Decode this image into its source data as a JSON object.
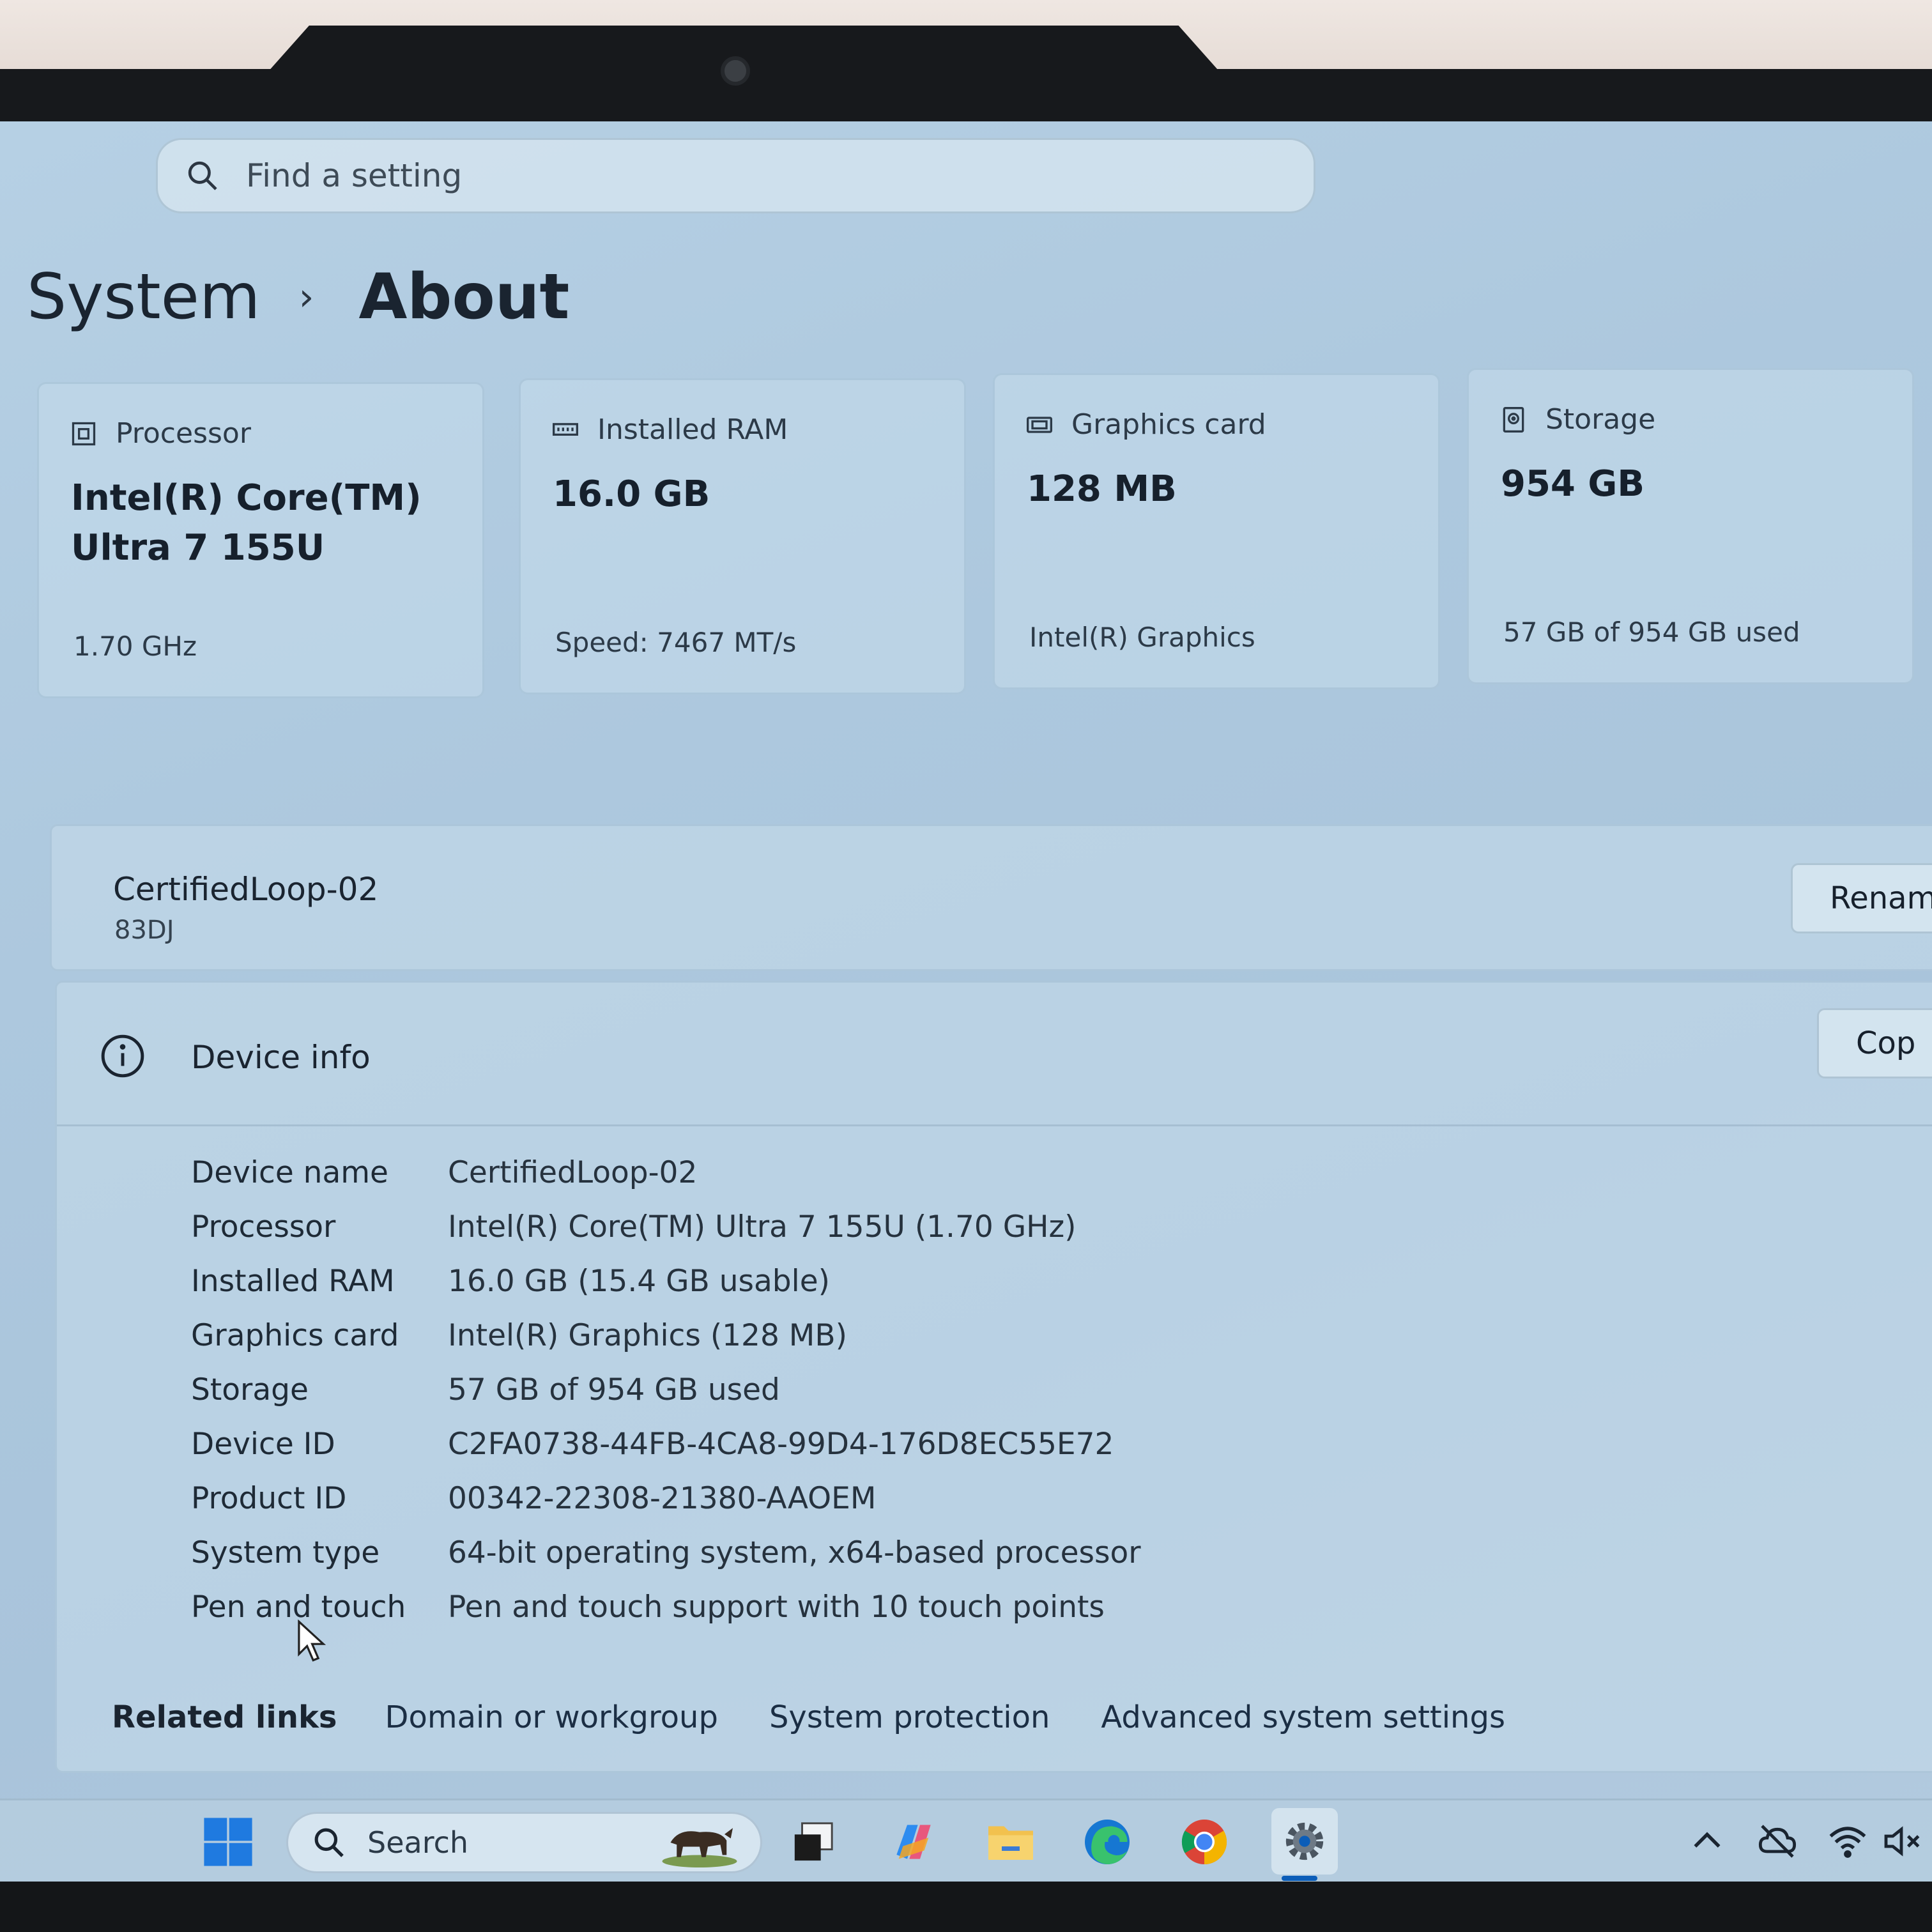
{
  "search": {
    "placeholder": "Find a setting"
  },
  "breadcrumb": {
    "root": "System",
    "separator": "›",
    "current": "About"
  },
  "cards": [
    {
      "title": "Processor",
      "icon": "processor-icon",
      "value": "Intel(R) Core(TM) Ultra 7 155U",
      "sub": "1.70 GHz"
    },
    {
      "title": "Installed RAM",
      "icon": "ram-icon",
      "value": "16.0 GB",
      "sub": "Speed: 7467 MT/s"
    },
    {
      "title": "Graphics card",
      "icon": "graphics-card-icon",
      "value": "128 MB",
      "sub": "Intel(R) Graphics"
    },
    {
      "title": "Storage",
      "icon": "storage-icon",
      "value": "954 GB",
      "sub": "57 GB of 954 GB used"
    }
  ],
  "device": {
    "name": "CertifiedLoop-02",
    "model": "83DJ",
    "rename_label": "Rename"
  },
  "device_info": {
    "title": "Device info",
    "copy_label": "Cop",
    "rows": [
      {
        "label": "Device name",
        "value": "CertifiedLoop-02"
      },
      {
        "label": "Processor",
        "value": "Intel(R) Core(TM) Ultra 7 155U (1.70 GHz)"
      },
      {
        "label": "Installed RAM",
        "value": "16.0 GB (15.4 GB usable)"
      },
      {
        "label": "Graphics card",
        "value": "Intel(R) Graphics (128 MB)"
      },
      {
        "label": "Storage",
        "value": "57 GB of 954 GB used"
      },
      {
        "label": "Device ID",
        "value": "C2FA0738-44FB-4CA8-99D4-176D8EC55E72"
      },
      {
        "label": "Product ID",
        "value": "00342-22308-21380-AAOEM"
      },
      {
        "label": "System type",
        "value": "64-bit operating system, x64-based processor"
      },
      {
        "label": "Pen and touch",
        "value": "Pen and touch support with 10 touch points"
      }
    ]
  },
  "related_links": {
    "label": "Related links",
    "links": [
      "Domain or workgroup",
      "System protection",
      "Advanced system settings"
    ]
  },
  "taskbar": {
    "search_label": "Search",
    "apps": [
      "windows-start-icon",
      "task-view-icon",
      "copilot-icon",
      "file-explorer-icon",
      "edge-icon",
      "chrome-icon",
      "settings-icon"
    ],
    "tray": [
      "chevron-up-icon",
      "cloud-off-icon",
      "wifi-icon",
      "volume-muted-icon"
    ]
  },
  "colors": {
    "accent": "#0067c0",
    "background": "#adc8de"
  }
}
